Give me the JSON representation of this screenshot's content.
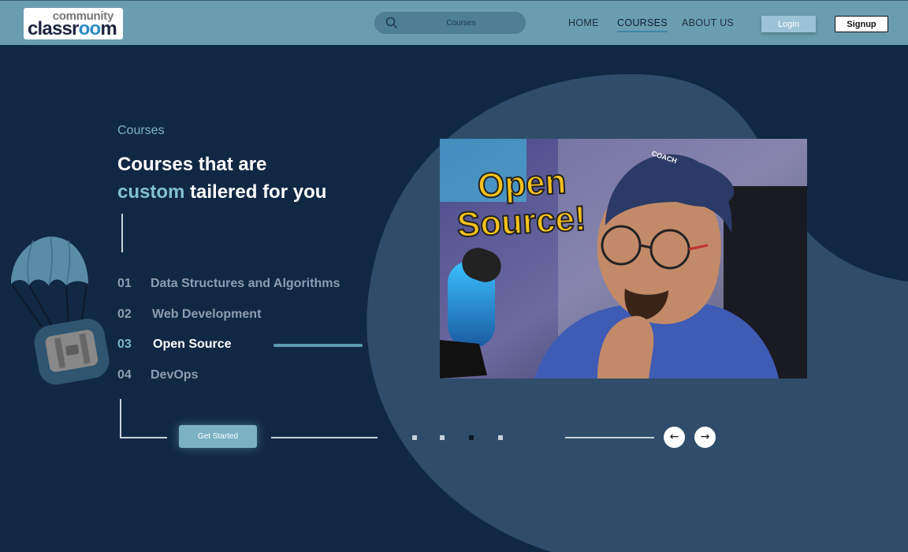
{
  "header": {
    "logo_top": "community",
    "logo_bottom_a": "classr",
    "logo_bottom_b": "oo",
    "logo_bottom_c": "m",
    "search_placeholder": "Courses",
    "nav": [
      "HOME",
      "COURSES",
      "ABOUT US"
    ],
    "active_nav": "COURSES",
    "login_label": "Login",
    "signup_label": "Signup"
  },
  "hero": {
    "eyebrow": "Courses",
    "heading_line1": "Courses that are",
    "heading_highlight": "custom",
    "heading_line2_rest": " tailered for you",
    "courses": [
      {
        "num": "01",
        "label": "Data Structures and Algorithms"
      },
      {
        "num": "02",
        "label": "Web Development"
      },
      {
        "num": "03",
        "label": "Open Source"
      },
      {
        "num": "04",
        "label": "DevOps"
      }
    ],
    "active_course": "03",
    "cta_label": "Get Started"
  },
  "video": {
    "thumbnail_text_1": "Open",
    "thumbnail_text_2": "Source!",
    "cap_text": "COACH"
  },
  "carousel": {
    "dot_count": 4,
    "active_dot": 3,
    "prev_icon": "←",
    "next_icon": "→"
  },
  "colors": {
    "background": "#112844",
    "header": "#6a9db0",
    "accent": "#7ab3c4",
    "blob": "#2f4d6a"
  }
}
